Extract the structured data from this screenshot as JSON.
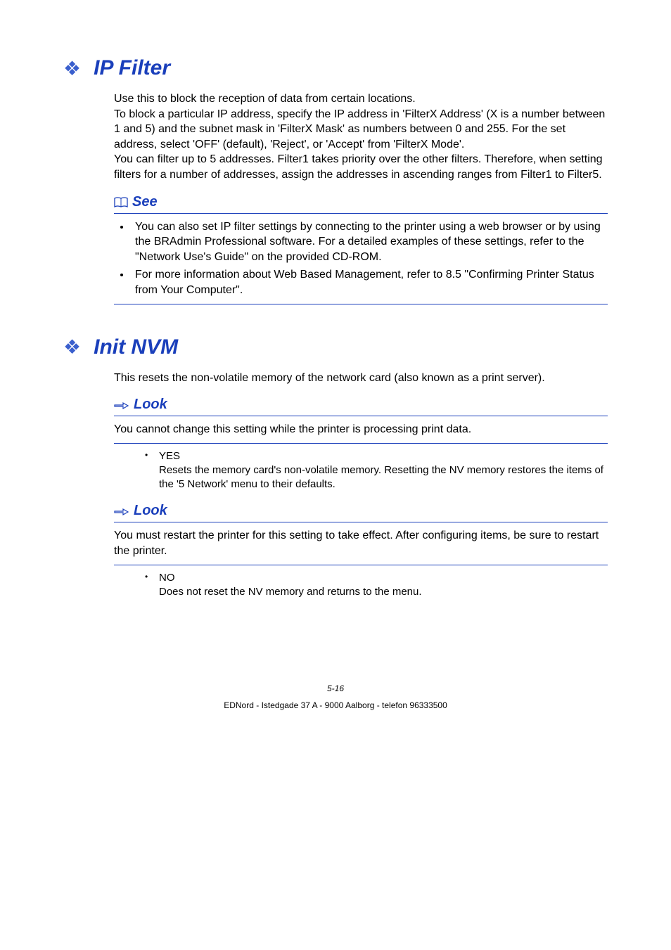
{
  "sections": [
    {
      "title": "IP Filter",
      "intro_paragraphs": [
        "Use this to block the reception of data from certain locations.",
        "To block a particular IP address, specify the IP address in 'FilterX Address' (X is a number between 1 and 5) and the subnet mask in 'FilterX Mask' as numbers between 0 and 255. For the set address, select 'OFF' (default), 'Reject', or 'Accept' from 'FilterX Mode'.",
        "You can filter up to 5 addresses. Filter1 takes priority over the other filters. Therefore, when setting filters for a number of addresses, assign the addresses in ascending ranges from Filter1 to Filter5."
      ],
      "see": {
        "label": "See",
        "items": [
          "You can also set IP filter settings by connecting to the printer using a web browser or by using the BRAdmin Professional software. For a detailed examples of these settings, refer to the \"Network Use's Guide\" on the provided CD-ROM.",
          "For more information about Web Based Management, refer to 8.5 \"Confirming Printer Status from Your Computer\"."
        ]
      }
    },
    {
      "title": "Init NVM",
      "intro_paragraphs": [
        "This resets the non-volatile memory of the network card (also known as a print server)."
      ],
      "look1": {
        "label": "Look",
        "text": "You cannot change this setting while the printer is processing print data."
      },
      "option_yes": {
        "label": "YES",
        "desc": "Resets the memory card's non-volatile memory. Resetting the NV memory restores the items of the '5 Network' menu to their defaults."
      },
      "look2": {
        "label": "Look",
        "text": "You must restart the printer for this setting to take effect. After configuring items, be sure to restart the printer."
      },
      "option_no": {
        "label": "NO",
        "desc": "Does not reset the NV memory and returns to the menu."
      }
    }
  ],
  "footer": {
    "page": "5-16",
    "vendor": "EDNord - Istedgade 37 A - 9000 Aalborg - telefon 96333500"
  }
}
